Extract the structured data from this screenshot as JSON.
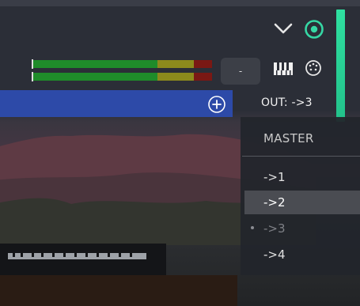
{
  "toolbar": {
    "dash_button_label": "-"
  },
  "output": {
    "label": "OUT: ->3"
  },
  "routing_menu": {
    "master_label": "MASTER",
    "items": [
      {
        "label": "->1"
      },
      {
        "label": "->2"
      },
      {
        "label": "->3"
      },
      {
        "label": "->4"
      }
    ],
    "highlighted_index": 1,
    "current_index": 2
  },
  "colors": {
    "accent_green": "#2fe0a0",
    "track_bar_blue": "#2d4aa8",
    "meter_green": "#1f8c2a",
    "meter_yellow": "#8c8a1c",
    "meter_red": "#7a1814"
  },
  "icons": {
    "collapse": "chevron-down-icon",
    "target": "target-icon",
    "piano": "piano-keys-icon",
    "dial": "dial-icon",
    "add": "add-circle-icon"
  }
}
